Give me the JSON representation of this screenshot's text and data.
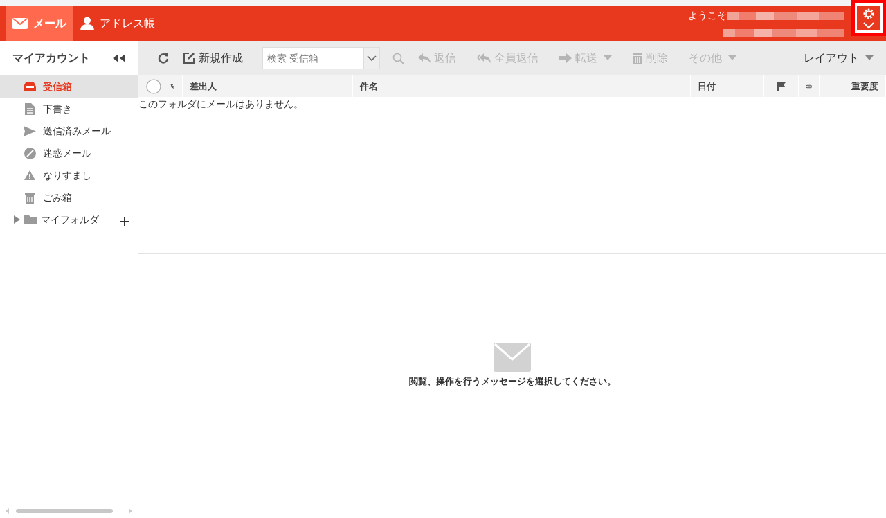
{
  "header": {
    "tabs": [
      {
        "label": "メール",
        "selected": true
      },
      {
        "label": "アドレス帳",
        "selected": false
      }
    ],
    "welcome": "ようこそ",
    "settings_highlighted": true
  },
  "sidebar": {
    "title": "マイアカウント",
    "folders": [
      {
        "label": "受信箱",
        "selected": true
      },
      {
        "label": "下書き",
        "selected": false
      },
      {
        "label": "送信済みメール",
        "selected": false
      },
      {
        "label": "迷惑メール",
        "selected": false
      },
      {
        "label": "なりすまし",
        "selected": false
      },
      {
        "label": "ごみ箱",
        "selected": false
      },
      {
        "label": "マイフォルダ",
        "selected": false,
        "expanded": false
      }
    ]
  },
  "toolbar": [
    {
      "kind": "icon",
      "disabled": false
    },
    {
      "kind": "button",
      "label": "新規作成",
      "disabled": false
    },
    {
      "kind": "search",
      "placeholder": "検索 受信箱"
    },
    {
      "kind": "icon",
      "disabled": true
    },
    {
      "kind": "button",
      "label": "返信",
      "disabled": true
    },
    {
      "kind": "button",
      "label": "全員返信",
      "disabled": true
    },
    {
      "kind": "dropdown",
      "label": "転送",
      "disabled": true
    },
    {
      "kind": "button",
      "label": "削除",
      "disabled": true
    },
    {
      "kind": "dropdown",
      "label": "その他",
      "disabled": true
    },
    {
      "kind": "dropdown",
      "label": "レイアウト",
      "disabled": false
    }
  ],
  "table": {
    "columns": [
      {
        "kind": "select",
        "checked": false
      },
      {
        "kind": "thread"
      },
      {
        "kind": "text",
        "label": "差出人"
      },
      {
        "kind": "text",
        "label": "件名"
      },
      {
        "kind": "text",
        "label": "日付"
      },
      {
        "kind": "flag"
      },
      {
        "kind": "attachment"
      },
      {
        "kind": "text",
        "label": "重要度"
      }
    ],
    "empty_message": "このフォルダにメールはありません。"
  },
  "preview": {
    "message": "閲覧、操作を行うメッセージを選択してください。"
  }
}
